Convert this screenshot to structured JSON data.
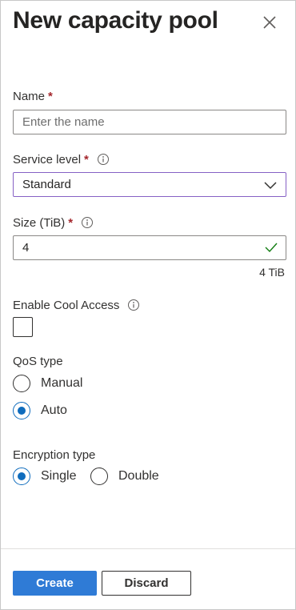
{
  "header": {
    "title": "New capacity pool"
  },
  "name_field": {
    "label": "Name",
    "required": "*",
    "placeholder": "Enter the name",
    "value": ""
  },
  "service_level": {
    "label": "Service level",
    "required": "*",
    "value": "Standard"
  },
  "size": {
    "label": "Size (TiB)",
    "required": "*",
    "value": "4",
    "hint": "4 TiB"
  },
  "cool_access": {
    "label": "Enable Cool Access",
    "checked": false
  },
  "qos": {
    "label": "QoS type",
    "options": [
      "Manual",
      "Auto"
    ],
    "selected": "Auto"
  },
  "encryption": {
    "label": "Encryption type",
    "options": [
      "Single",
      "Double"
    ],
    "selected": "Single"
  },
  "footer": {
    "create_label": "Create",
    "discard_label": "Discard"
  },
  "colors": {
    "primary": "#2f7bd6",
    "focus_border": "#8661c5",
    "valid": "#107c10",
    "required": "#a4262c",
    "radio_checked": "#0f6cbd"
  },
  "icons": {
    "close": "close-icon",
    "info": "info-icon",
    "chevron": "chevron-down-icon",
    "valid": "checkmark-icon"
  }
}
